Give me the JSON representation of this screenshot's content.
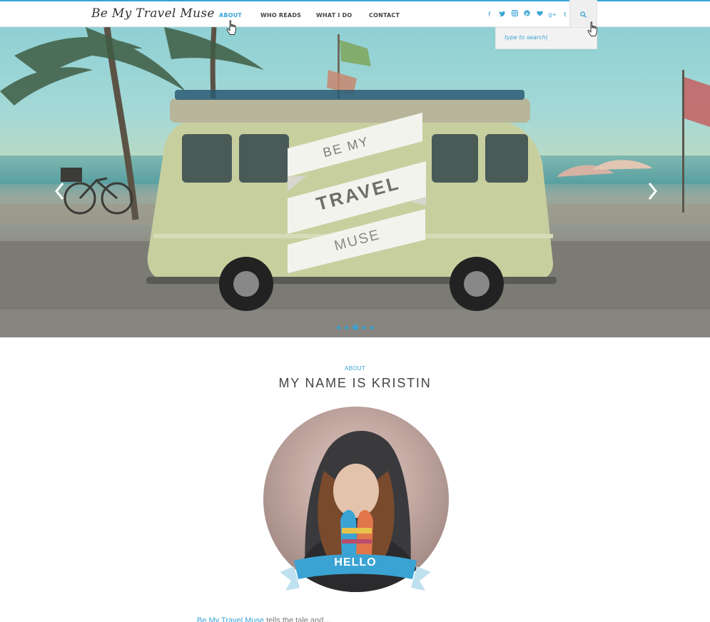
{
  "site": {
    "logo_text": "Be My Travel Muse"
  },
  "nav": {
    "items": [
      {
        "label": "About",
        "active": true
      },
      {
        "label": "Who Reads",
        "active": false
      },
      {
        "label": "What I Do",
        "active": false
      },
      {
        "label": "Contact",
        "active": false
      }
    ]
  },
  "social_icons": [
    "facebook-icon",
    "twitter-icon",
    "instagram-icon",
    "pinterest-icon",
    "heart-icon",
    "google-plus-icon",
    "tumblr-icon"
  ],
  "search": {
    "icon": "search-icon",
    "placeholder": "type to search|"
  },
  "hero": {
    "badge_line1": "BE MY",
    "badge_line2": "TRAVEL",
    "badge_line3": "MUSE",
    "slide_count": 5,
    "active_slide_index": 2
  },
  "about": {
    "kicker": "ABOUT",
    "title": "MY NAME IS KRISTIN",
    "ribbon_text": "HELLO",
    "intro_link": "Be My Travel Muse",
    "intro_rest": " tells the tale and…"
  },
  "colors": {
    "accent": "#3aa3d4",
    "text": "#444444",
    "background": "#ffffff"
  }
}
